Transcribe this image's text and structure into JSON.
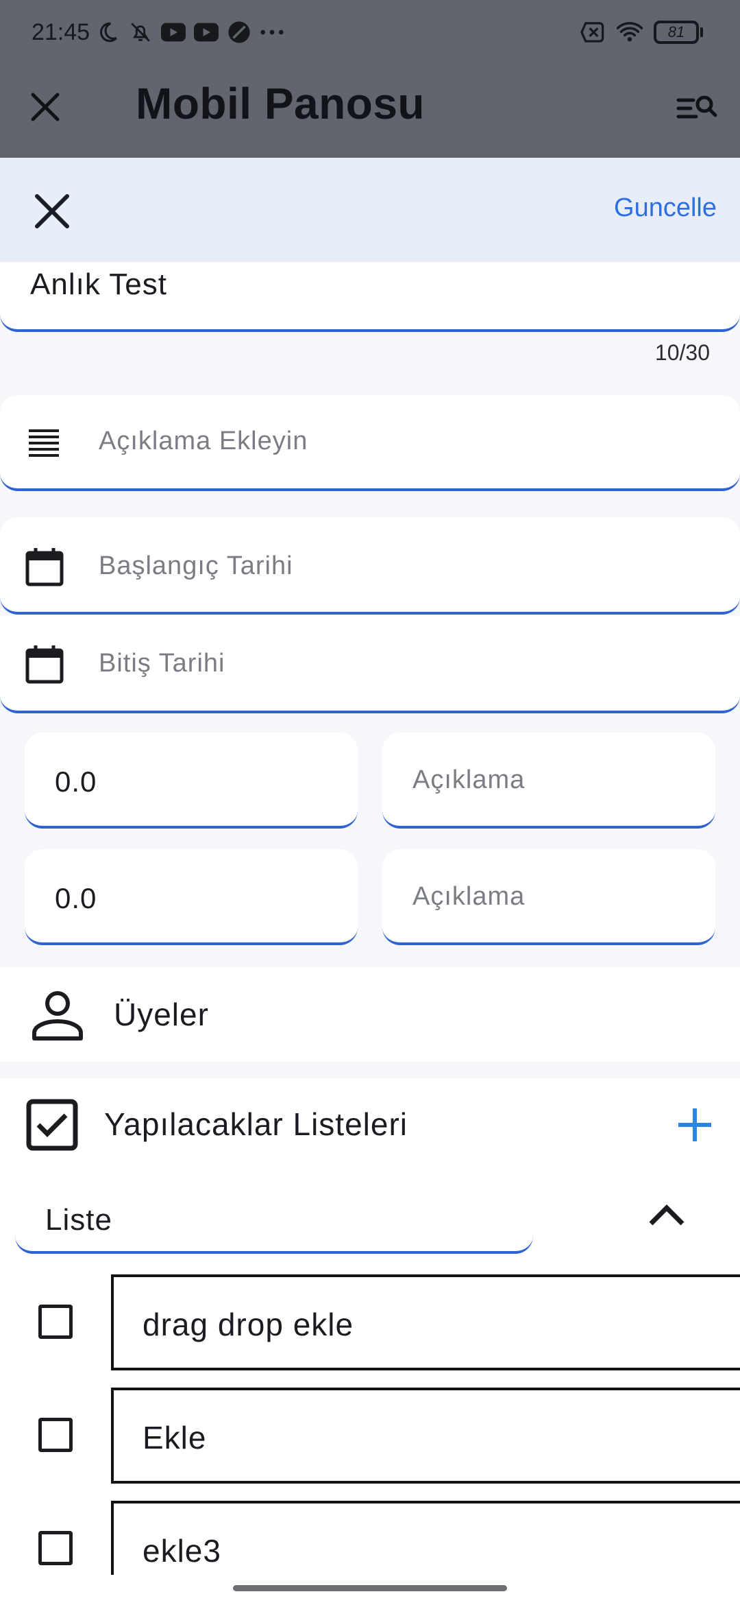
{
  "status_bar": {
    "time": "21:45",
    "battery": "81",
    "icons_left": [
      "moon-icon",
      "bell-off-icon",
      "youtube-icon",
      "youtube-icon",
      "app-icon",
      "more-dots-icon"
    ],
    "icons_right": [
      "no-sim-icon",
      "wifi-icon",
      "battery-icon"
    ]
  },
  "app_bar": {
    "title": "Mobil Panosu"
  },
  "edit_bar": {
    "update_label": "Guncelle"
  },
  "form": {
    "title_value": "Anlık Test",
    "title_counter": "10/30",
    "description_placeholder": "Açıklama Ekleyin",
    "start_date_placeholder": "Başlangıç Tarihi",
    "end_date_placeholder": "Bitiş Tarihi",
    "amount_rows": [
      {
        "value": "0.0",
        "desc_placeholder": "Açıklama"
      },
      {
        "value": "0.0",
        "desc_placeholder": "Açıklama"
      }
    ]
  },
  "members": {
    "label": "Üyeler"
  },
  "todo": {
    "section_label": "Yapılacaklar Listeleri",
    "list_name": "Liste",
    "items": [
      {
        "text": "drag drop ekle",
        "checked": false
      },
      {
        "text": "Ekle",
        "checked": false
      },
      {
        "text": "ekle3",
        "checked": false
      }
    ]
  },
  "colors": {
    "accent": "#2f63d1",
    "link": "#2d6ee0",
    "add": "#2a86e0",
    "dim": "#61656e",
    "edit_bar_bg": "#e8eef9"
  }
}
